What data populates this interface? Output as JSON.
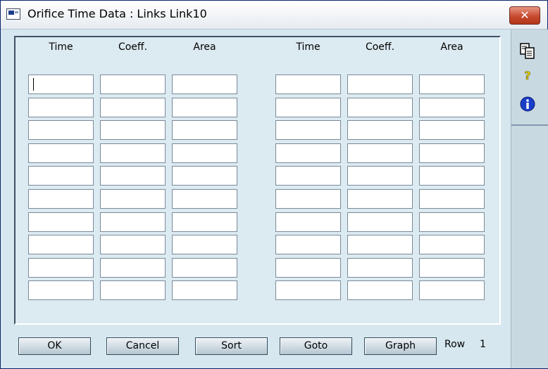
{
  "window": {
    "title": "Orifice Time Data : Links Link10",
    "close_glyph": "✕"
  },
  "table": {
    "headers": [
      "Time",
      "Coeff.",
      "Area",
      "Time",
      "Coeff.",
      "Area"
    ],
    "rows": [
      [
        "",
        "",
        "",
        "",
        "",
        ""
      ],
      [
        "",
        "",
        "",
        "",
        "",
        ""
      ],
      [
        "",
        "",
        "",
        "",
        "",
        ""
      ],
      [
        "",
        "",
        "",
        "",
        "",
        ""
      ],
      [
        "",
        "",
        "",
        "",
        "",
        ""
      ],
      [
        "",
        "",
        "",
        "",
        "",
        ""
      ],
      [
        "",
        "",
        "",
        "",
        "",
        ""
      ],
      [
        "",
        "",
        "",
        "",
        "",
        ""
      ],
      [
        "",
        "",
        "",
        "",
        "",
        ""
      ],
      [
        "",
        "",
        "",
        "",
        "",
        ""
      ]
    ]
  },
  "buttons": {
    "ok": "OK",
    "cancel": "Cancel",
    "sort": "Sort",
    "goto": "Goto",
    "graph": "Graph"
  },
  "status": {
    "row_label": "Row",
    "row_value": "1"
  },
  "side_icons": [
    "copy-icon",
    "help-icon",
    "info-icon"
  ],
  "colors": {
    "background": "#dceaf1",
    "close_button": "#c74a2f",
    "info_icon": "#1a3ec8",
    "help_icon": "#e0d000"
  }
}
